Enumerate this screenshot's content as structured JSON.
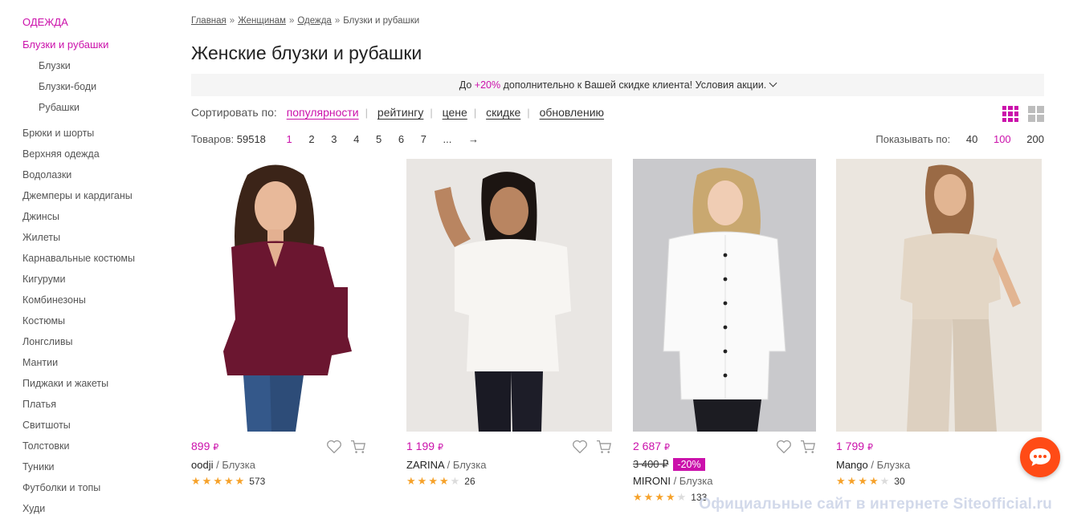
{
  "sidebar": {
    "root": "ОДЕЖДА",
    "active": "Блузки и рубашки",
    "subitems": [
      "Блузки",
      "Блузки-боди",
      "Рубашки"
    ],
    "items": [
      "Брюки и шорты",
      "Верхняя одежда",
      "Водолазки",
      "Джемперы и кардиганы",
      "Джинсы",
      "Жилеты",
      "Карнавальные костюмы",
      "Кигуруми",
      "Комбинезоны",
      "Костюмы",
      "Лонгсливы",
      "Мантии",
      "Пиджаки и жакеты",
      "Платья",
      "Свитшоты",
      "Толстовки",
      "Туники",
      "Футболки и топы",
      "Худи"
    ]
  },
  "breadcrumb": [
    "Главная",
    "Женщинам",
    "Одежда",
    "Блузки и рубашки"
  ],
  "breadcrumb_separator": "»",
  "page_title": "Женские блузки и рубашки",
  "promo": {
    "prefix": "До",
    "percent": "+20%",
    "text": "дополнительно к Вашей скидке клиента!",
    "link": "Условия акции."
  },
  "sort": {
    "label": "Сортировать по:",
    "options": [
      "популярности",
      "рейтингу",
      "цене",
      "скидке",
      "обновлению"
    ],
    "active_index": 0
  },
  "count": {
    "label": "Товаров:",
    "value": "59518"
  },
  "pagination": {
    "pages": [
      "1",
      "2",
      "3",
      "4",
      "5",
      "6",
      "7",
      "...",
      "→"
    ],
    "current": "1"
  },
  "show_by": {
    "label": "Показывать по:",
    "options": [
      "40",
      "100",
      "200"
    ],
    "current": "100"
  },
  "products": [
    {
      "price": "899",
      "currency": "₽",
      "brand": "oodji",
      "type": "Блузка",
      "stars": 5,
      "reviews": "573",
      "old_price": "",
      "discount": ""
    },
    {
      "price": "1 199",
      "currency": "₽",
      "brand": "ZARINA",
      "type": "Блузка",
      "stars": 4,
      "reviews": "26",
      "old_price": "",
      "discount": ""
    },
    {
      "price": "2 687",
      "currency": "₽",
      "brand": "MIRONI",
      "type": "Блузка",
      "stars": 4,
      "reviews": "133",
      "old_price": "3 400 ₽",
      "discount": "-20%"
    },
    {
      "price": "1 799",
      "currency": "₽",
      "brand": "Mango",
      "type": "Блузка",
      "stars": 4,
      "reviews": "30",
      "old_price": "",
      "discount": ""
    }
  ],
  "watermark": "Официальные сайт в интернете Siteofficial.ru",
  "colors": {
    "accent": "#cb11ab",
    "star": "#f6a22b",
    "chat": "#ff4b16"
  }
}
